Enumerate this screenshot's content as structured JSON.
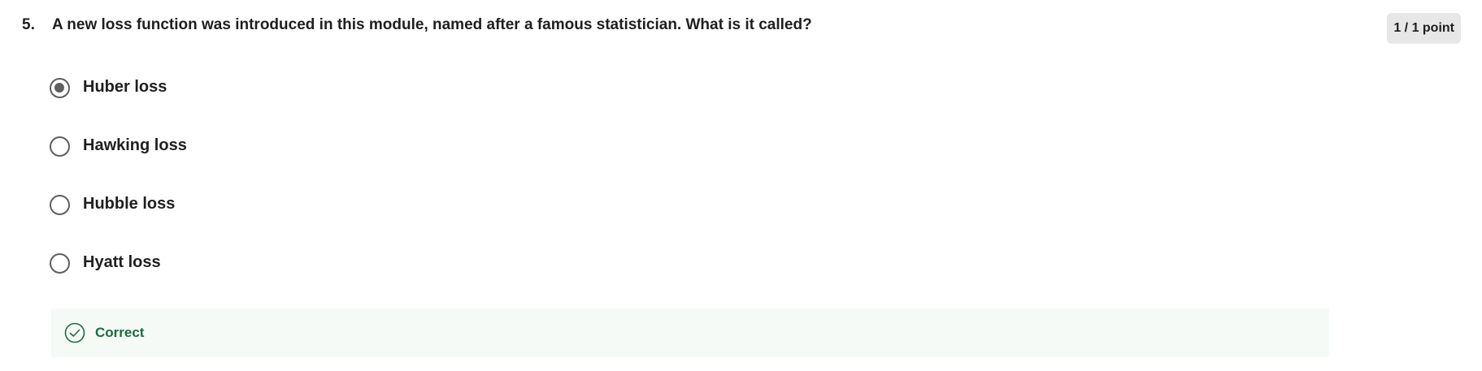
{
  "question": {
    "number": "5.",
    "text": "A new loss function was introduced in this module, named after a famous statistician. What is it called?",
    "points": "1 / 1 point"
  },
  "options": [
    {
      "label": "Huber loss",
      "selected": true
    },
    {
      "label": "Hawking loss",
      "selected": false
    },
    {
      "label": "Hubble loss",
      "selected": false
    },
    {
      "label": "Hyatt loss",
      "selected": false
    }
  ],
  "feedback": {
    "label": "Correct",
    "icon": "check-circle-icon",
    "color": "#1e6b3e"
  },
  "colors": {
    "radio": "#5f5f5f",
    "badge_bg": "#e7e7e7",
    "feedback_bg": "#f5faf7"
  }
}
